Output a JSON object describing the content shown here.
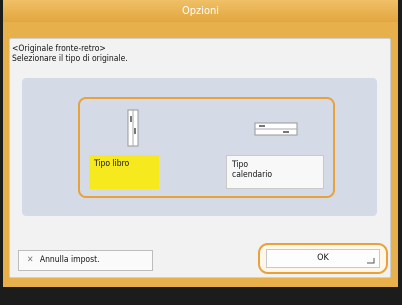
{
  "window": {
    "title": "Opzioni"
  },
  "instructions": {
    "line1": "<Originale fronte-retro>",
    "line2": "Selezionare il tipo di originale."
  },
  "options": [
    {
      "label": "Tipo libro",
      "selected": true,
      "icon": "book-original-icon"
    },
    {
      "label_line1": "Tipo",
      "label_line2": "calendario",
      "selected": false,
      "icon": "calendar-original-icon"
    }
  ],
  "footer": {
    "cancel_label": "Annulla impost.",
    "ok_label": "OK"
  },
  "colors": {
    "accent": "#e9a13a",
    "selected_bg": "#f6ea1f",
    "title_bg": "#e6ab45",
    "panel_inner": "#d4dbe7"
  }
}
